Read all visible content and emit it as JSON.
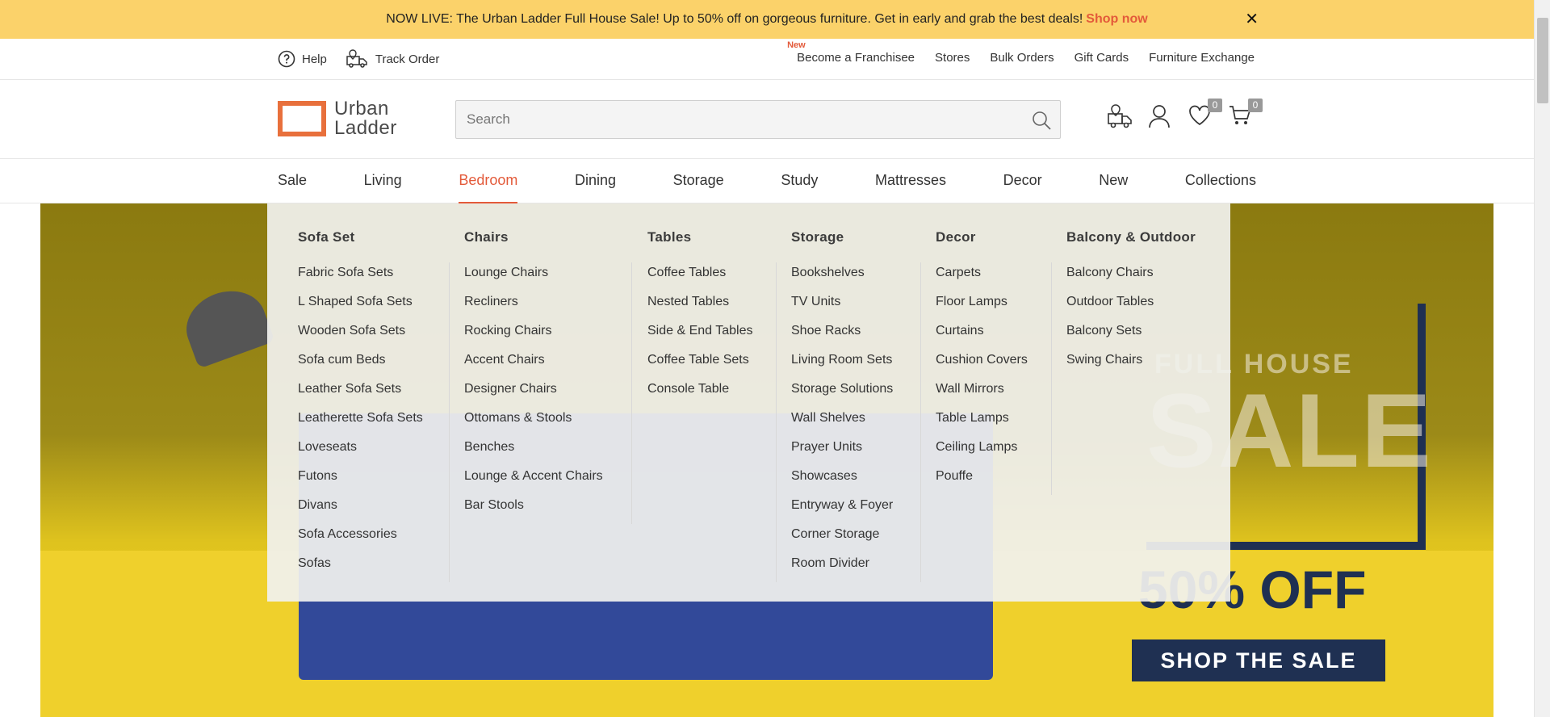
{
  "promo": {
    "text": "NOW LIVE: The Urban Ladder Full House Sale! Up to 50% off on gorgeous furniture. Get in early and grab the best deals!",
    "cta": "Shop now",
    "close": "✕"
  },
  "util": {
    "help": "Help",
    "track": "Track Order",
    "new_tag": "New",
    "links": [
      "Become a Franchisee",
      "Stores",
      "Bulk Orders",
      "Gift Cards",
      "Furniture Exchange"
    ]
  },
  "header": {
    "logo_line1": "Urban",
    "logo_line2": "Ladder",
    "search_placeholder": "Search",
    "wishlist_count": "0",
    "cart_count": "0"
  },
  "nav": {
    "items": [
      "Sale",
      "Living",
      "Bedroom",
      "Dining",
      "Storage",
      "Study",
      "Mattresses",
      "Decor",
      "New",
      "Collections"
    ],
    "active": "Bedroom"
  },
  "hero": {
    "sale_top": "FULL HOUSE",
    "sale_big": "SALE",
    "off": "50% OFF",
    "button": "SHOP THE SALE"
  },
  "menu": {
    "columns": [
      {
        "title": "Sofa Set",
        "items": [
          "Fabric Sofa Sets",
          "L Shaped Sofa Sets",
          "Wooden Sofa Sets",
          "Sofa cum Beds",
          "Leather Sofa Sets",
          "Leatherette Sofa Sets",
          "Loveseats",
          "Futons",
          "Divans",
          "Sofa Accessories",
          "Sofas"
        ]
      },
      {
        "title": "Chairs",
        "items": [
          "Lounge Chairs",
          "Recliners",
          "Rocking Chairs",
          "Accent Chairs",
          "Designer Chairs",
          "Ottomans & Stools",
          "Benches",
          "Lounge & Accent Chairs",
          "Bar Stools"
        ]
      },
      {
        "title": "Tables",
        "items": [
          "Coffee Tables",
          "Nested Tables",
          "Side & End Tables",
          "Coffee Table Sets",
          "Console Table"
        ]
      },
      {
        "title": "Storage",
        "items": [
          "Bookshelves",
          "TV Units",
          "Shoe Racks",
          "Living Room Sets",
          "Storage Solutions",
          "Wall Shelves",
          "Prayer Units",
          "Showcases",
          "Entryway & Foyer",
          "Corner Storage",
          "Room Divider"
        ]
      },
      {
        "title": "Decor",
        "items": [
          "Carpets",
          "Floor Lamps",
          "Curtains",
          "Cushion Covers",
          "Wall Mirrors",
          "Table Lamps",
          "Ceiling Lamps",
          "Pouffe"
        ]
      },
      {
        "title": "Balcony & Outdoor",
        "items": [
          "Balcony Chairs",
          "Outdoor Tables",
          "Balcony Sets",
          "Swing Chairs"
        ]
      }
    ]
  },
  "colors": {
    "accent": "#e35a3a",
    "promo_bg": "#fbd26a",
    "logo": "#e8703c",
    "navy": "#1f3052"
  }
}
